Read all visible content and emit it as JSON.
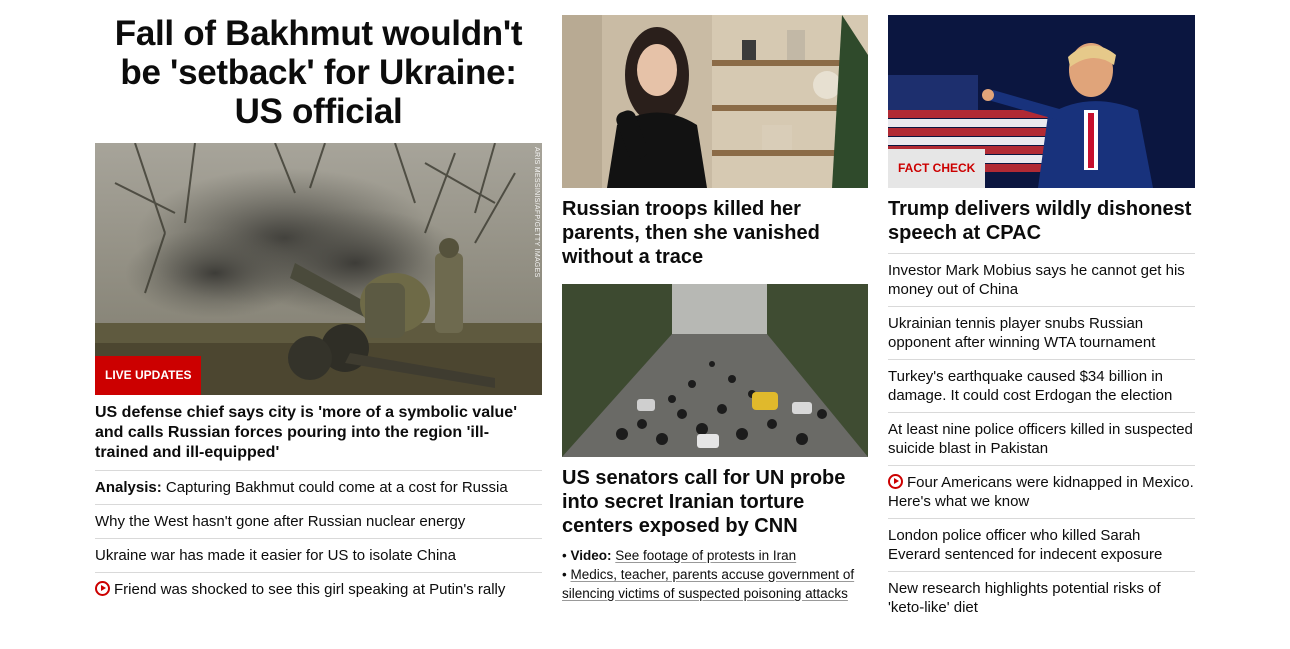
{
  "column1": {
    "headline": "Fall of Bakhmut wouldn't be 'setback' for Ukraine: US official",
    "image_credit": "ARIS MESSINIS/AFP/GETTY IMAGES",
    "badge": "LIVE UPDATES",
    "lead": "US defense chief says city is 'more of a symbolic value' and calls Russian forces pouring into the region 'ill-trained and ill-equipped'",
    "links": [
      {
        "prefix": "Analysis:",
        "text": "Capturing Bakhmut could come at a cost for Russia"
      },
      {
        "text": "Why the West hasn't gone after Russian nuclear energy"
      },
      {
        "text": "Ukraine war has made it easier for US to isolate China"
      },
      {
        "text": "Friend was shocked to see this girl speaking at Putin's rally",
        "icon": "play-icon"
      }
    ]
  },
  "column2": {
    "story1_title": "Russian troops killed her parents, then she vanished without a trace",
    "story2_title": "US senators call for UN probe into secret Iranian torture centers exposed by CNN",
    "sub_links": [
      {
        "bullet": "•",
        "prefix": "Video:",
        "text": "See footage of protests in Iran"
      },
      {
        "bullet": "•",
        "text": "Medics, teacher, parents accuse government of silencing victims of suspected poisoning attacks"
      }
    ]
  },
  "column3": {
    "badge": "FACT CHECK",
    "story_title": "Trump delivers wildly dishonest speech at CPAC",
    "links": [
      {
        "text": "Investor Mark Mobius says he cannot get his money out of China"
      },
      {
        "text": "Ukrainian tennis player snubs Russian opponent after winning WTA tournament"
      },
      {
        "text": "Turkey's earthquake caused $34 billion in damage. It could cost Erdogan the election"
      },
      {
        "text": "At least nine police officers killed in suspected suicide blast in Pakistan"
      },
      {
        "text": "Four Americans were kidnapped in Mexico. Here's what we know",
        "icon": "play-icon"
      },
      {
        "text": "London police officer who killed Sarah Everard sentenced for indecent exposure"
      },
      {
        "text": "New research highlights potential risks of 'keto-like' diet"
      }
    ]
  },
  "colors": {
    "accent": "#cc0000",
    "divider": "#d9d9d9",
    "text": "#0c0c0c"
  }
}
